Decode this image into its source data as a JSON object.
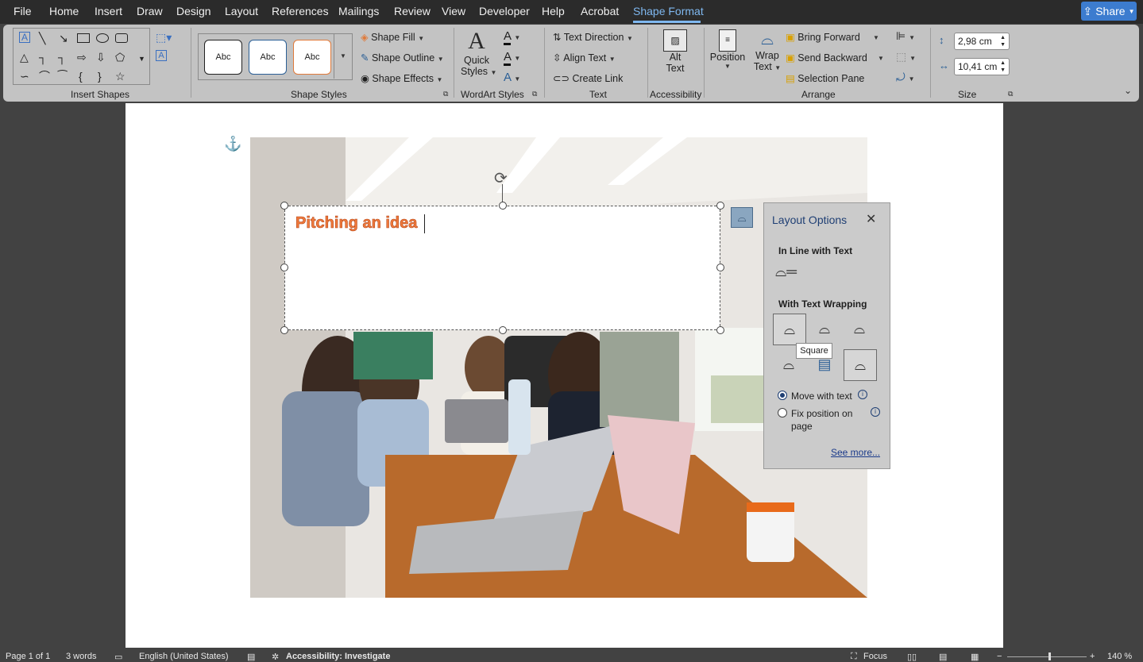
{
  "menu": {
    "items": [
      "File",
      "Home",
      "Insert",
      "Draw",
      "Design",
      "Layout",
      "References",
      "Mailings",
      "Review",
      "View",
      "Developer",
      "Help",
      "Acrobat",
      "Shape Format"
    ],
    "active": "Shape Format",
    "share_label": "Share"
  },
  "ribbon": {
    "insert_shapes": {
      "label": "Insert Shapes"
    },
    "shape_styles": {
      "label": "Shape Styles",
      "presets": [
        "Abc",
        "Abc",
        "Abc"
      ],
      "shape_fill": "Shape Fill",
      "shape_outline": "Shape Outline",
      "shape_effects": "Shape Effects"
    },
    "wordart": {
      "label": "WordArt Styles",
      "quick_styles_line1": "Quick",
      "quick_styles_line2": "Styles"
    },
    "text": {
      "label": "Text",
      "text_direction": "Text Direction",
      "align_text": "Align Text",
      "create_link": "Create Link"
    },
    "accessibility": {
      "label": "Accessibility",
      "alt_text_line1": "Alt",
      "alt_text_line2": "Text"
    },
    "arrange": {
      "label": "Arrange",
      "position": "Position",
      "wrap_text_line1": "Wrap",
      "wrap_text_line2": "Text",
      "bring_forward": "Bring Forward",
      "send_backward": "Send Backward",
      "selection_pane": "Selection Pane"
    },
    "size": {
      "label": "Size",
      "height": "2,98 cm",
      "width": "10,41 cm"
    }
  },
  "document": {
    "textbox_text": "Pitching an idea"
  },
  "layout_options": {
    "title": "Layout Options",
    "inline_heading": "In Line with Text",
    "wrapping_heading": "With Text Wrapping",
    "tooltip": "Square",
    "move_with_text": "Move with text",
    "fix_position_line1": "Fix position on",
    "fix_position_line2": "page",
    "see_more": "See more...",
    "selected_option": "Move with text"
  },
  "status": {
    "page": "Page 1 of 1",
    "words": "3 words",
    "language": "English (United States)",
    "accessibility": "Accessibility: Investigate",
    "focus": "Focus",
    "zoom": "140 %"
  },
  "colors": {
    "accent": "#7fb8f0",
    "share": "#3c7ccf",
    "wordart_orange": "#f07a3c",
    "link": "#1a3a8a"
  }
}
